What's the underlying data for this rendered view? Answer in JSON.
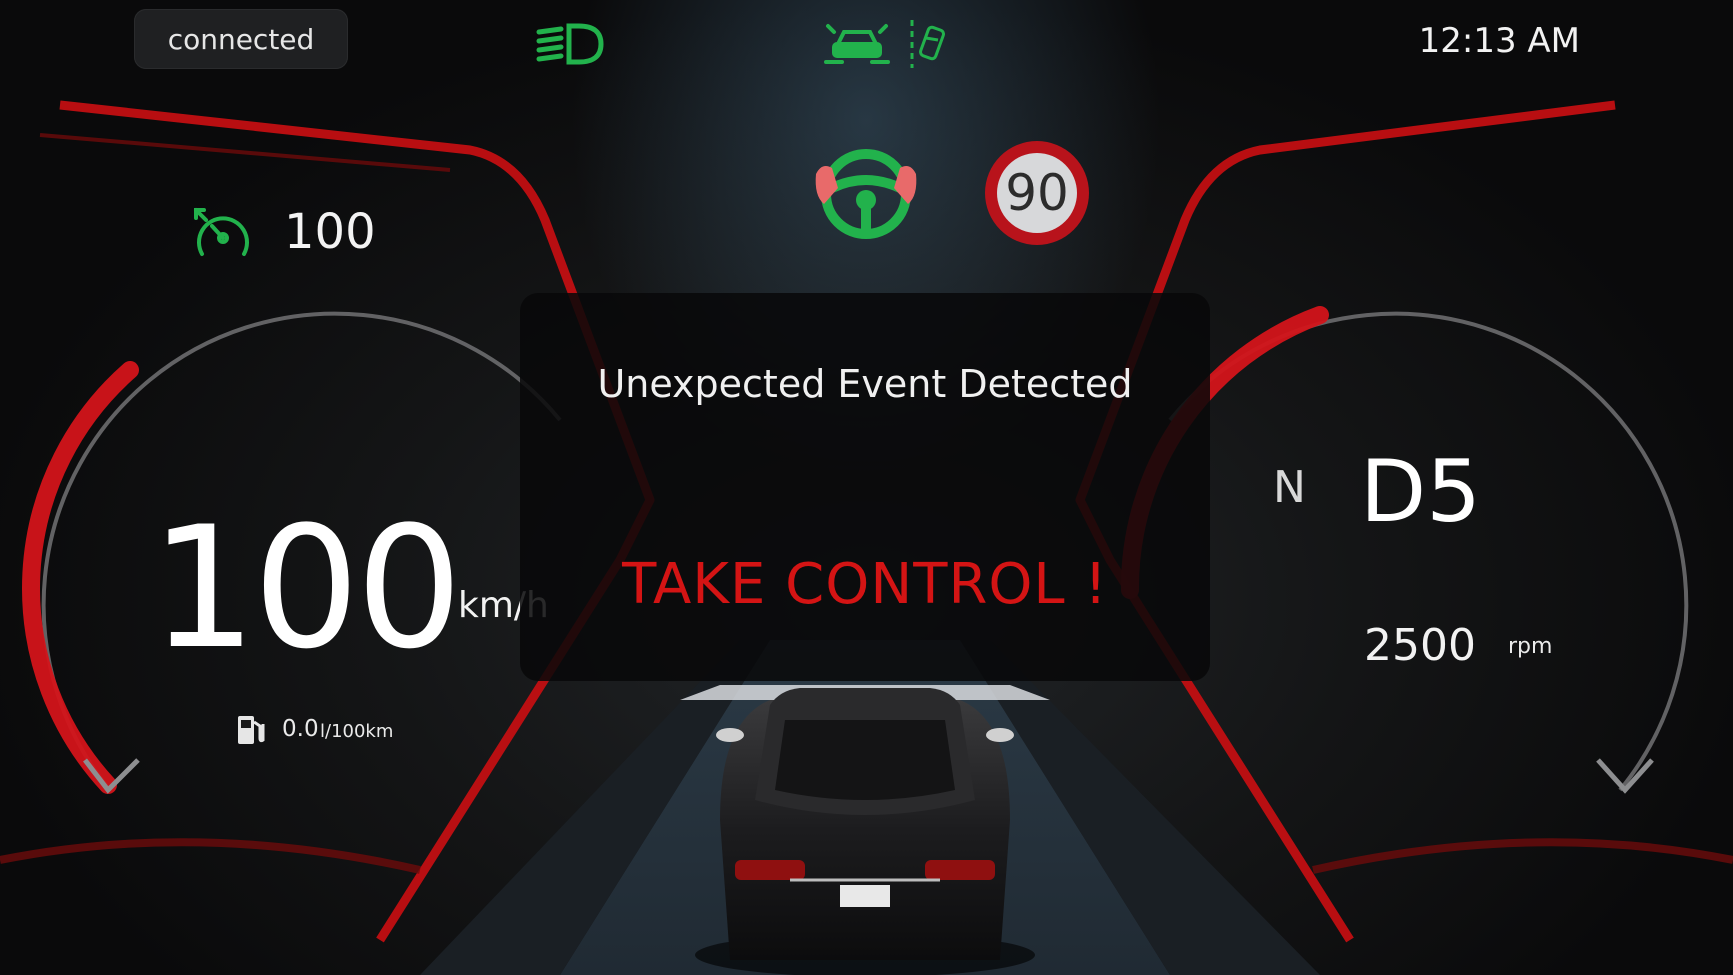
{
  "top_bar": {
    "connection_status": "connected",
    "time": "12:13 AM",
    "headlight_icon": "low-beam-headlight-icon",
    "assist_icons": [
      "lane-assist-icon",
      "lane-departure-icon"
    ]
  },
  "cruise": {
    "set_speed": "100",
    "icon": "cruise-control-icon"
  },
  "speed": {
    "value": "100",
    "unit": "km/h"
  },
  "consumption": {
    "value": "0.0",
    "unit": "l/100km",
    "icon": "fuel-pump-icon"
  },
  "gear": {
    "mode": "N",
    "value": "D5"
  },
  "engine": {
    "rpm": "2500",
    "unit": "rpm"
  },
  "speed_limit": {
    "value": "90"
  },
  "alert": {
    "title": "Unexpected Event Detected",
    "action": "TAKE CONTROL !"
  },
  "colors": {
    "accent_red": "#d41414",
    "indicator_green": "#22b24c",
    "background": "#141516"
  }
}
